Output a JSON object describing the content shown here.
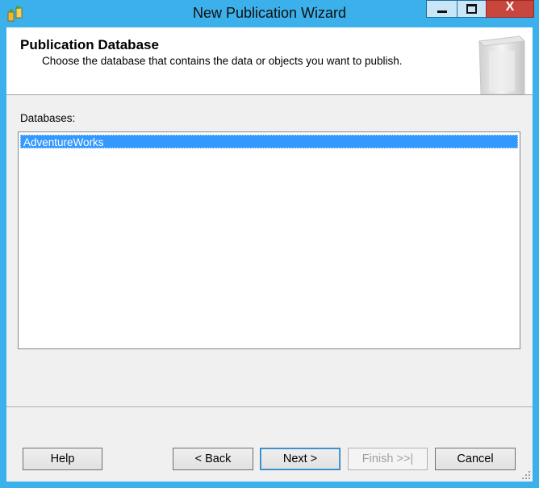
{
  "window": {
    "title": "New Publication Wizard",
    "controls": {
      "minimize": "minimize",
      "maximize": "maximize",
      "close": "X"
    }
  },
  "header": {
    "title": "Publication Database",
    "subtitle": "Choose the database that contains the data or objects you want to publish."
  },
  "databases": {
    "label": "Databases:",
    "items": [
      "AdventureWorks"
    ],
    "selected": "AdventureWorks"
  },
  "buttons": {
    "help": "Help",
    "back": "< Back",
    "next": "Next >",
    "finish": "Finish >>|",
    "cancel": "Cancel"
  },
  "colors": {
    "frame": "#3cb0ea",
    "selection": "#3399ff",
    "close": "#c7463d"
  }
}
